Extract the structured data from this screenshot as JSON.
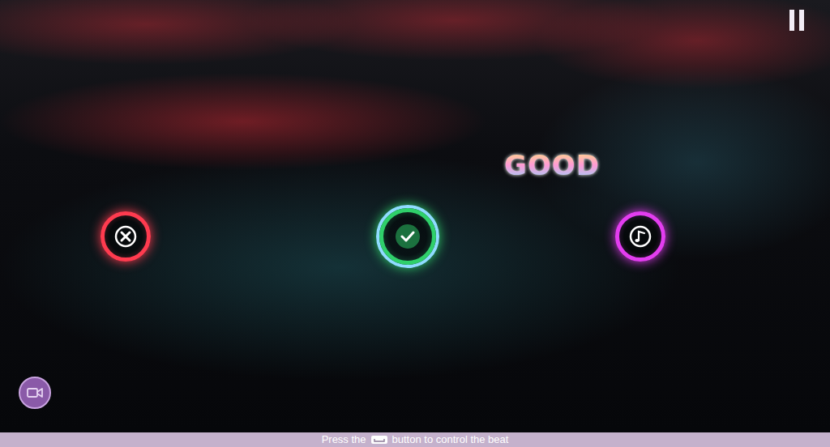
{
  "hud": {
    "rating": "GOOD",
    "hint": {
      "before": "Press the",
      "after": "button to control the beat"
    }
  },
  "beat_buttons": [
    {
      "kind": "cross",
      "color": "#ff3b4f",
      "selected": false
    },
    {
      "kind": "check",
      "color": "#2fd06a",
      "selected": true
    },
    {
      "kind": "note",
      "color": "#e33df0",
      "selected": false
    }
  ]
}
